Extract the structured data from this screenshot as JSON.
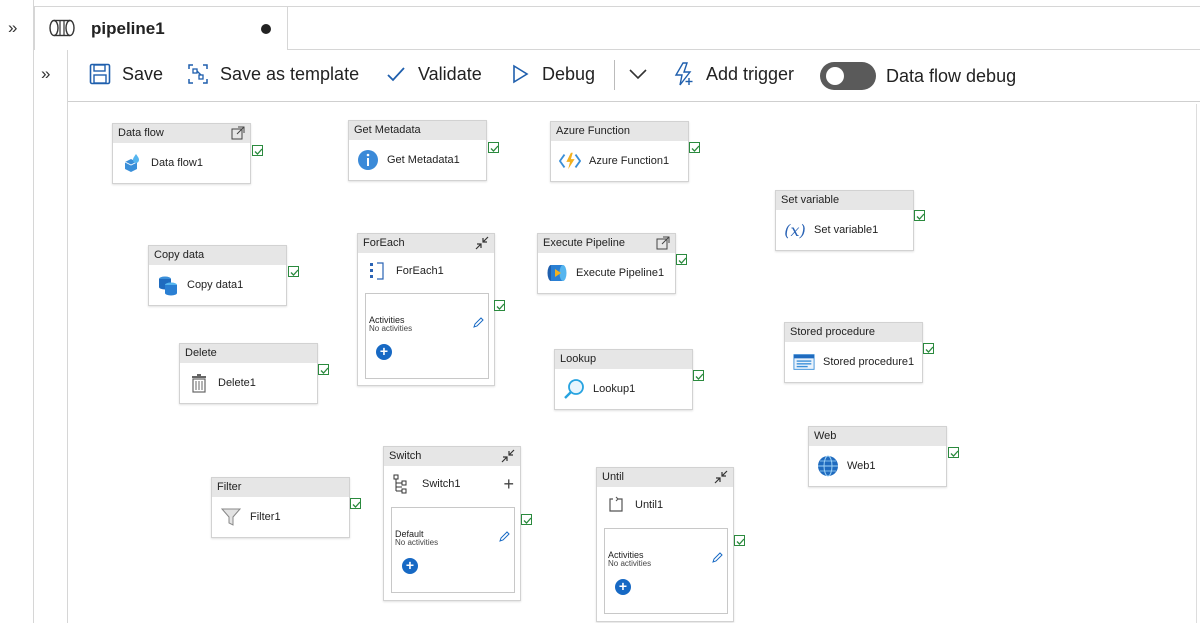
{
  "tab": {
    "title": "pipeline1"
  },
  "toolbar": {
    "save": "Save",
    "save_as_template": "Save as template",
    "validate": "Validate",
    "debug": "Debug",
    "add_trigger": "Add trigger",
    "data_flow_debug": "Data flow debug"
  },
  "activities": {
    "dataflow": {
      "type": "Data flow",
      "name": "Data flow1"
    },
    "getmetadata": {
      "type": "Get Metadata",
      "name": "Get Metadata1"
    },
    "azurefunction": {
      "type": "Azure Function",
      "name": "Azure Function1"
    },
    "setvariable": {
      "type": "Set variable",
      "name": "Set variable1"
    },
    "copydata": {
      "type": "Copy data",
      "name": "Copy data1"
    },
    "foreach": {
      "type": "ForEach",
      "name": "ForEach1",
      "inner_label": "Activities",
      "inner_sub": "No activities"
    },
    "executepipeline": {
      "type": "Execute Pipeline",
      "name": "Execute Pipeline1"
    },
    "storedprocedure": {
      "type": "Stored procedure",
      "name": "Stored procedure1"
    },
    "delete": {
      "type": "Delete",
      "name": "Delete1"
    },
    "lookup": {
      "type": "Lookup",
      "name": "Lookup1"
    },
    "web": {
      "type": "Web",
      "name": "Web1"
    },
    "switch": {
      "type": "Switch",
      "name": "Switch1",
      "inner_label": "Default",
      "inner_sub": "No activities"
    },
    "until": {
      "type": "Until",
      "name": "Until1",
      "inner_label": "Activities",
      "inner_sub": "No activities"
    },
    "filter": {
      "type": "Filter",
      "name": "Filter1"
    }
  }
}
